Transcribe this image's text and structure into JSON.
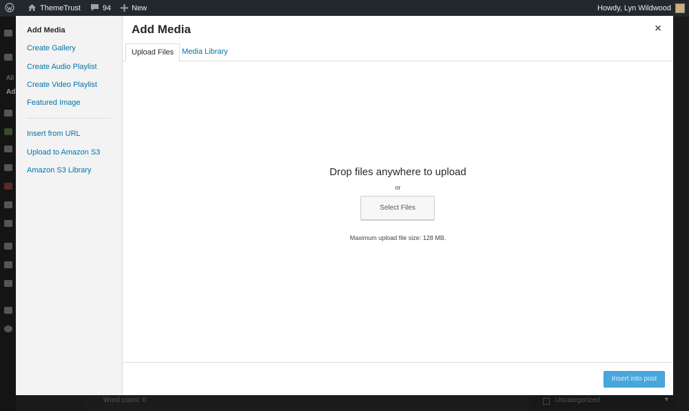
{
  "adminbar": {
    "site_name": "ThemeTrust",
    "comments_count": "94",
    "new_label": "New",
    "howdy": "Howdy, Lyn Wildwood"
  },
  "background": {
    "menu_text_all": "All",
    "menu_text_add": "Ad",
    "word_count": "Word count: 0",
    "category": "Uncategorized"
  },
  "modal": {
    "menu": {
      "items_top": [
        {
          "label": "Add Media"
        },
        {
          "label": "Create Gallery"
        },
        {
          "label": "Create Audio Playlist"
        },
        {
          "label": "Create Video Playlist"
        },
        {
          "label": "Featured Image"
        }
      ],
      "items_bottom": [
        {
          "label": "Insert from URL"
        },
        {
          "label": "Upload to Amazon S3"
        },
        {
          "label": "Amazon S3 Library"
        }
      ]
    },
    "title": "Add Media",
    "close": "×",
    "tabs": [
      {
        "label": "Upload Files"
      },
      {
        "label": "Media Library"
      }
    ],
    "upload": {
      "drop_text": "Drop files anywhere to upload",
      "or_text": "or",
      "select_button": "Select Files",
      "max_size": "Maximum upload file size: 128 MB."
    },
    "toolbar": {
      "insert_button": "Insert into post"
    }
  }
}
